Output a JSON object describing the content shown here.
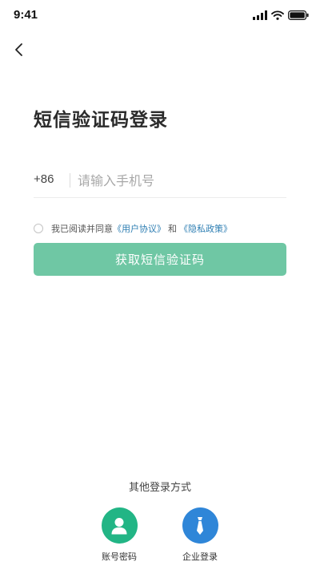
{
  "status_bar": {
    "time": "9:41"
  },
  "header": {
    "back_icon": "chevron-left-icon"
  },
  "page": {
    "title": "短信验证码登录"
  },
  "phone": {
    "country_code": "+86",
    "placeholder": "请输入手机号"
  },
  "agreement": {
    "prefix": "我已阅读并同意",
    "user_agreement": "《用户协议》",
    "conjunction": "和",
    "privacy_policy": "《隐私政策》",
    "link_color": "#2f7fb3"
  },
  "submit": {
    "label": "获取短信验证码",
    "color": "#6fc7a4"
  },
  "other_login": {
    "title": "其他登录方式",
    "options": [
      {
        "label": "账号密码",
        "icon": "user-icon",
        "color": "#22b585"
      },
      {
        "label": "企业登录",
        "icon": "tie-icon",
        "color": "#2f86d8"
      }
    ]
  }
}
